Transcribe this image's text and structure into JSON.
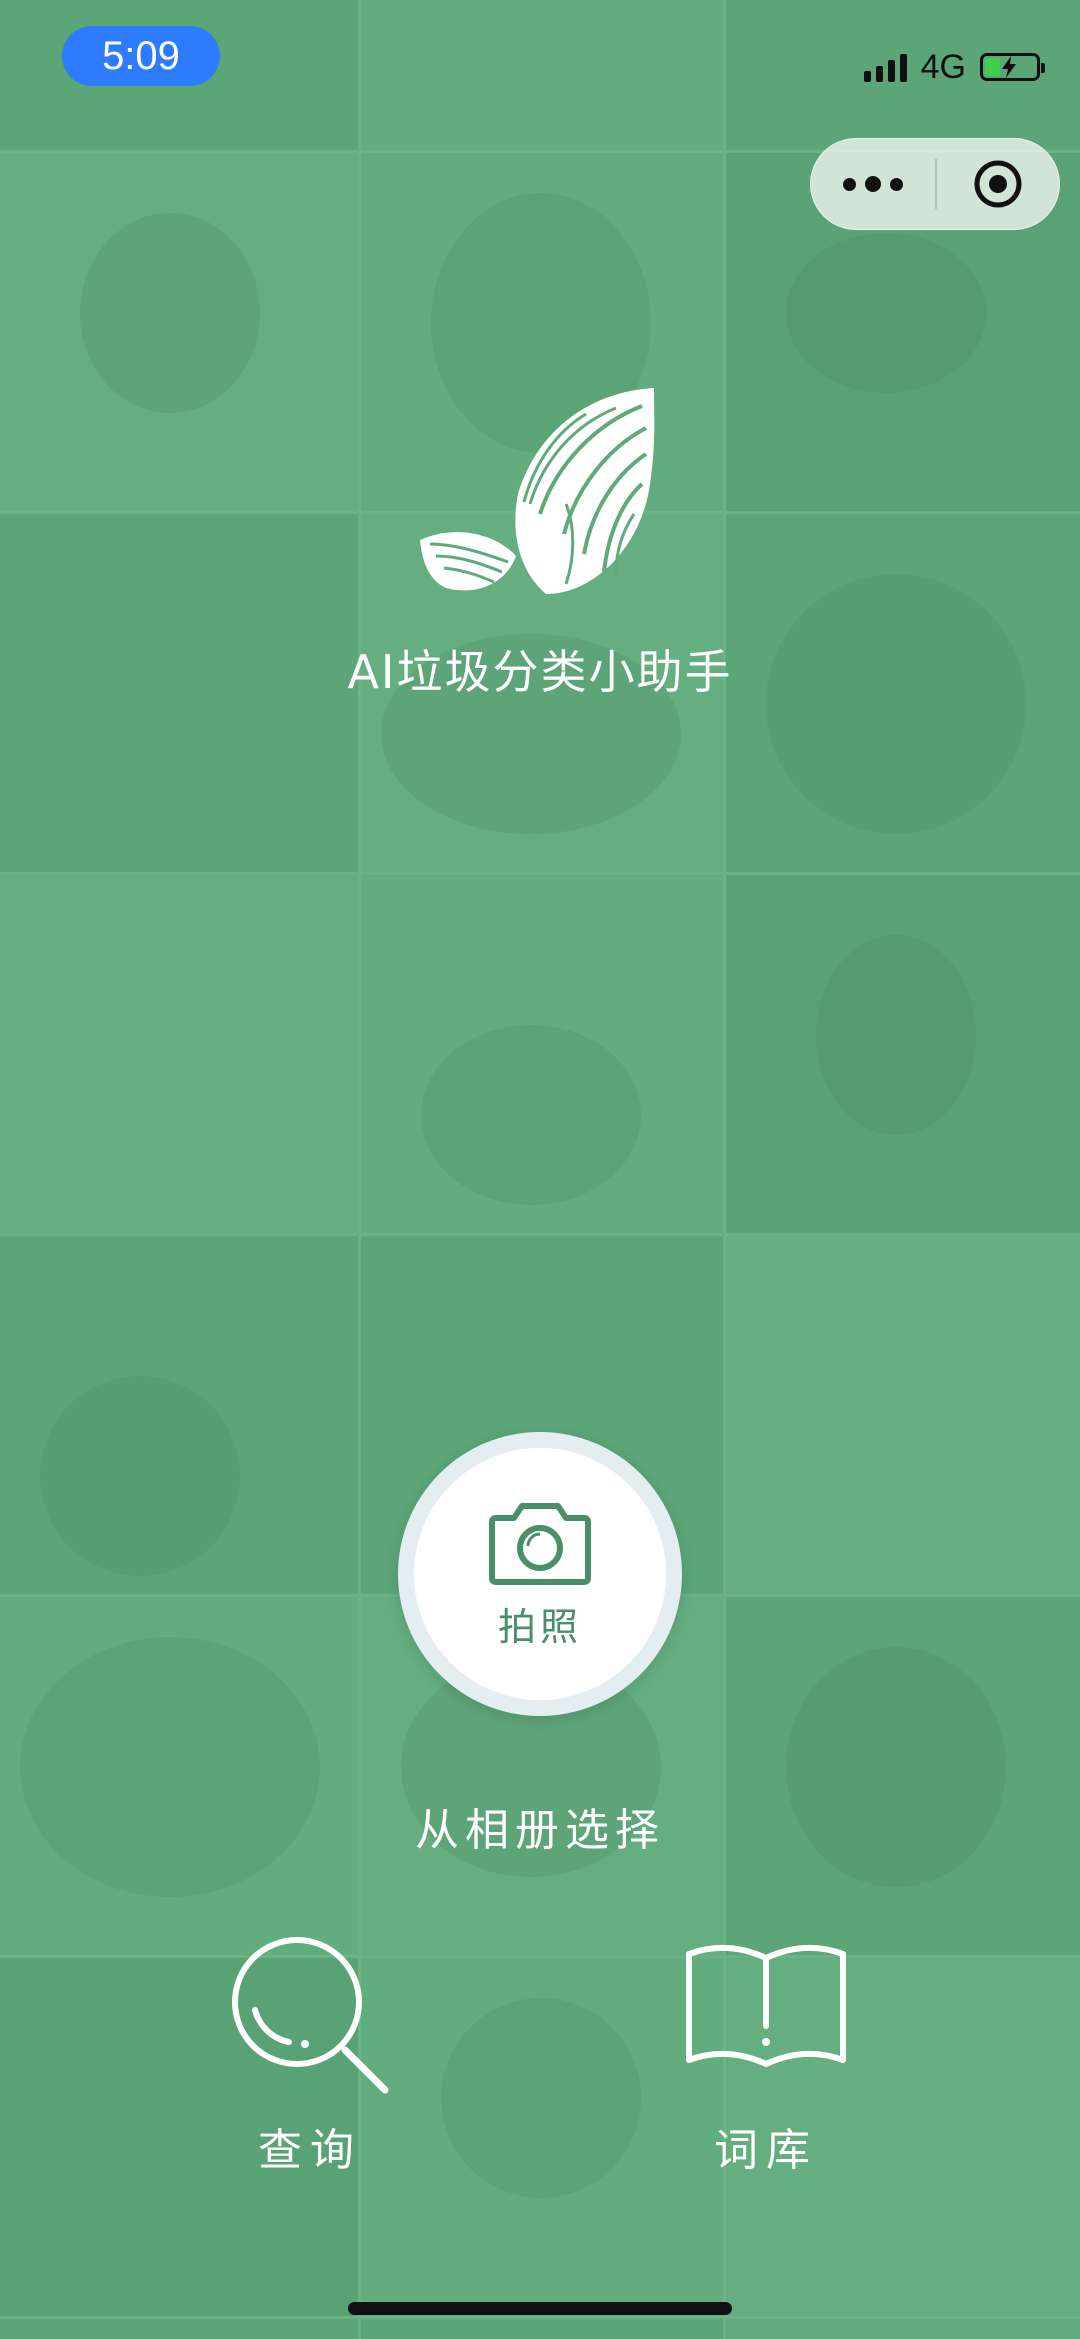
{
  "status_bar": {
    "time": "5:09",
    "network": "4G",
    "battery_level": 0.3
  },
  "capsule_menu": {
    "more_icon": "more-dots-icon",
    "close_icon": "target-circle-icon"
  },
  "header": {
    "logo_icon": "fingerprint-leaf-icon",
    "title": "AI垃圾分类小助手"
  },
  "camera": {
    "icon": "camera-icon",
    "label": "拍照"
  },
  "album": {
    "label": "从相册选择"
  },
  "actions": {
    "search": {
      "icon": "search-icon",
      "label": "查询"
    },
    "library": {
      "icon": "book-icon",
      "label": "词库"
    }
  },
  "colors": {
    "background": "#5fa97b",
    "accent": "#4b8f6a",
    "time_pill": "#2f7bff"
  }
}
